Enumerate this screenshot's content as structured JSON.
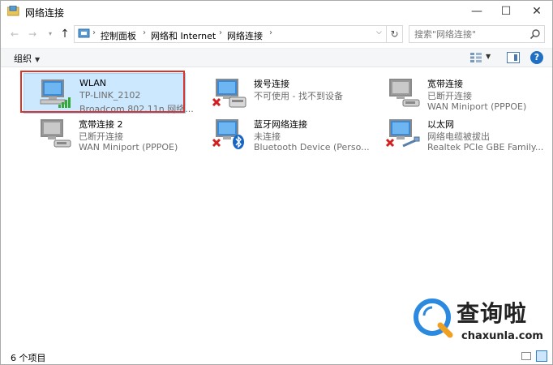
{
  "window": {
    "title": "网络连接",
    "min_glyph": "—",
    "max_glyph": "☐",
    "close_glyph": "✕"
  },
  "nav": {
    "back_glyph": "←",
    "forward_glyph": "→",
    "recent_glyph": "▾",
    "up_glyph": "↑",
    "breadcrumbs": [
      "控制面板",
      "网络和 Internet",
      "网络连接"
    ],
    "separator": "›",
    "dropdown_glyph": "⌵",
    "refresh_glyph": "↻",
    "search_placeholder": "搜索\"网络连接\""
  },
  "toolbar": {
    "organize_label": "组织",
    "organize_arrow": "▼",
    "view_arrow": "▼",
    "help_label": "?"
  },
  "connections": [
    {
      "name": "WLAN",
      "status": "TP-LINK_2102",
      "device": "Broadcom 802.11n 网络...",
      "badge": "wifi-signal",
      "selected": true
    },
    {
      "name": "拨号连接",
      "status": "不可使用 - 找不到设备",
      "device": "",
      "badge": "red-x"
    },
    {
      "name": "宽带连接",
      "status": "已断开连接",
      "device": "WAN Miniport (PPPOE)",
      "badge": "none"
    },
    {
      "name": "宽带连接 2",
      "status": "已断开连接",
      "device": "WAN Miniport (PPPOE)",
      "badge": "none"
    },
    {
      "name": "蓝牙网络连接",
      "status": "未连接",
      "device": "Bluetooth Device (Perso...",
      "badge": "red-x-bluetooth"
    },
    {
      "name": "以太网",
      "status": "网络电缆被拔出",
      "device": "Realtek PCIe GBE Family...",
      "badge": "red-x"
    }
  ],
  "statusbar": {
    "count_label": "6 个项目"
  },
  "watermark": {
    "title": "查询啦",
    "subtitle": "chaxunla.com"
  },
  "colors": {
    "selection_bg": "#cce8ff",
    "highlight_box": "#d9362b",
    "help_blue": "#1f6fc2"
  }
}
